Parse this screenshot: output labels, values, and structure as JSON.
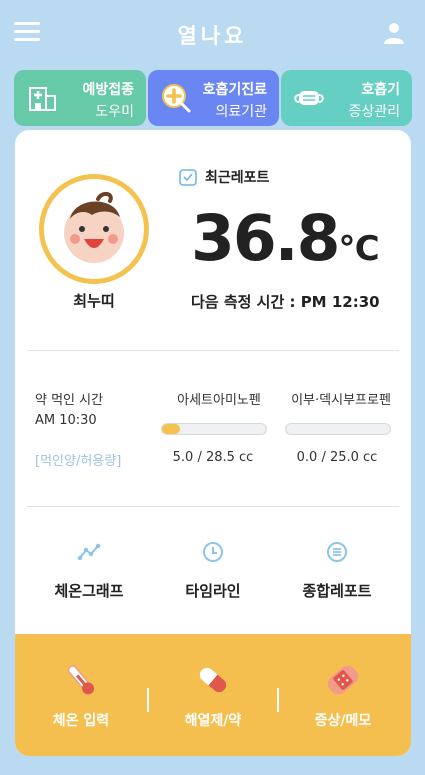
{
  "app": {
    "title": "열나요"
  },
  "header": {
    "menu_icon": "hamburger-icon",
    "profile_icon": "user-icon"
  },
  "tabs": [
    {
      "line1": "예방접종",
      "line2": "도우미",
      "color": "#66c9a7",
      "icon": "hospital-icon"
    },
    {
      "line1": "호흡기진료",
      "line2": "의료기관",
      "color": "#6a86f2",
      "icon": "search-plus-icon"
    },
    {
      "line1": "호흡기",
      "line2": "증상관리",
      "color": "#66cfc3",
      "icon": "mask-icon"
    }
  ],
  "profile": {
    "name": "최누띠"
  },
  "report": {
    "label": "최근레포트",
    "temperature": "36.8",
    "unit": "℃",
    "next_measure": "다음 측정 시간 : PM 12:30"
  },
  "medication": {
    "label": "약 먹인 시간",
    "time": "AM 10:30",
    "link": "[먹인양/허용량]",
    "drugs": [
      {
        "name": "아세트아미노펜",
        "value": "5.0 / 28.5 cc",
        "fraction": 0.175
      },
      {
        "name": "이부·덱시부프로펜",
        "value": "0.0 / 25.0 cc",
        "fraction": 0
      }
    ]
  },
  "report_nav": [
    {
      "label": "체온그래프",
      "icon": "graph-icon"
    },
    {
      "label": "타임라인",
      "icon": "clock-icon"
    },
    {
      "label": "종합레포트",
      "icon": "list-icon"
    }
  ],
  "actions": [
    {
      "label": "체온 입력",
      "icon": "thermometer-icon"
    },
    {
      "label": "해열제/약",
      "icon": "pill-icon"
    },
    {
      "label": "증상/메모",
      "icon": "bandage-icon"
    }
  ],
  "colors": {
    "background": "#b9daf0",
    "accent_yellow": "#f4bf4f",
    "tab_green": "#66c9a7",
    "tab_blue": "#6a86f2",
    "tab_teal": "#66cfc3"
  }
}
